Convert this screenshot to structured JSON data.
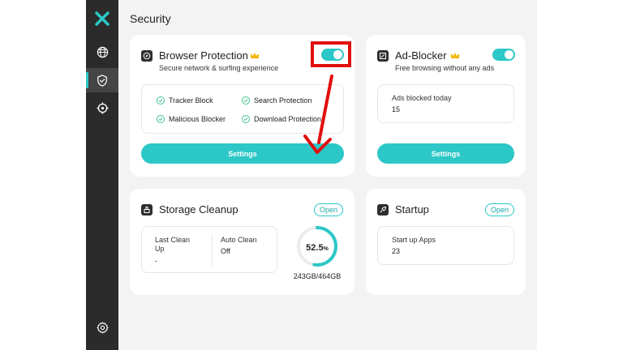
{
  "page_title": "Security",
  "colors": {
    "accent": "#2cc7c7",
    "sidebar": "#2b2b2b",
    "annotation": "#e20e0e"
  },
  "sidebar": {
    "items": [
      {
        "icon": "globe-icon"
      },
      {
        "icon": "shield-check-icon",
        "active": true
      },
      {
        "icon": "crosshair-icon"
      }
    ],
    "bottom_icon": "gear-icon"
  },
  "browser_protection": {
    "title": "Browser Protection",
    "subtitle": "Secure network & surfing experience",
    "enabled": true,
    "features": [
      "Tracker Block",
      "Search Protection",
      "Malicious Blocker",
      "Download Protection"
    ],
    "button": "Settings"
  },
  "ad_blocker": {
    "title": "Ad-Blocker",
    "subtitle": "Free browsing without any ads",
    "enabled": true,
    "stat_label": "Ads blocked today",
    "stat_value": "15",
    "button": "Settings"
  },
  "storage_cleanup": {
    "title": "Storage Cleanup",
    "open_button": "Open",
    "last_clean_label_1": "Last Clean",
    "last_clean_label_2": "Up",
    "last_clean_value": "-",
    "auto_clean_label": "Auto Clean",
    "auto_clean_value": "Off",
    "usage_percent": "52.5",
    "usage_unit": "%",
    "usage_fraction": 0.525,
    "usage_text": "243GB/464GB"
  },
  "startup": {
    "title": "Startup",
    "open_button": "Open",
    "stat_label": "Start up Apps",
    "stat_value": "23"
  }
}
